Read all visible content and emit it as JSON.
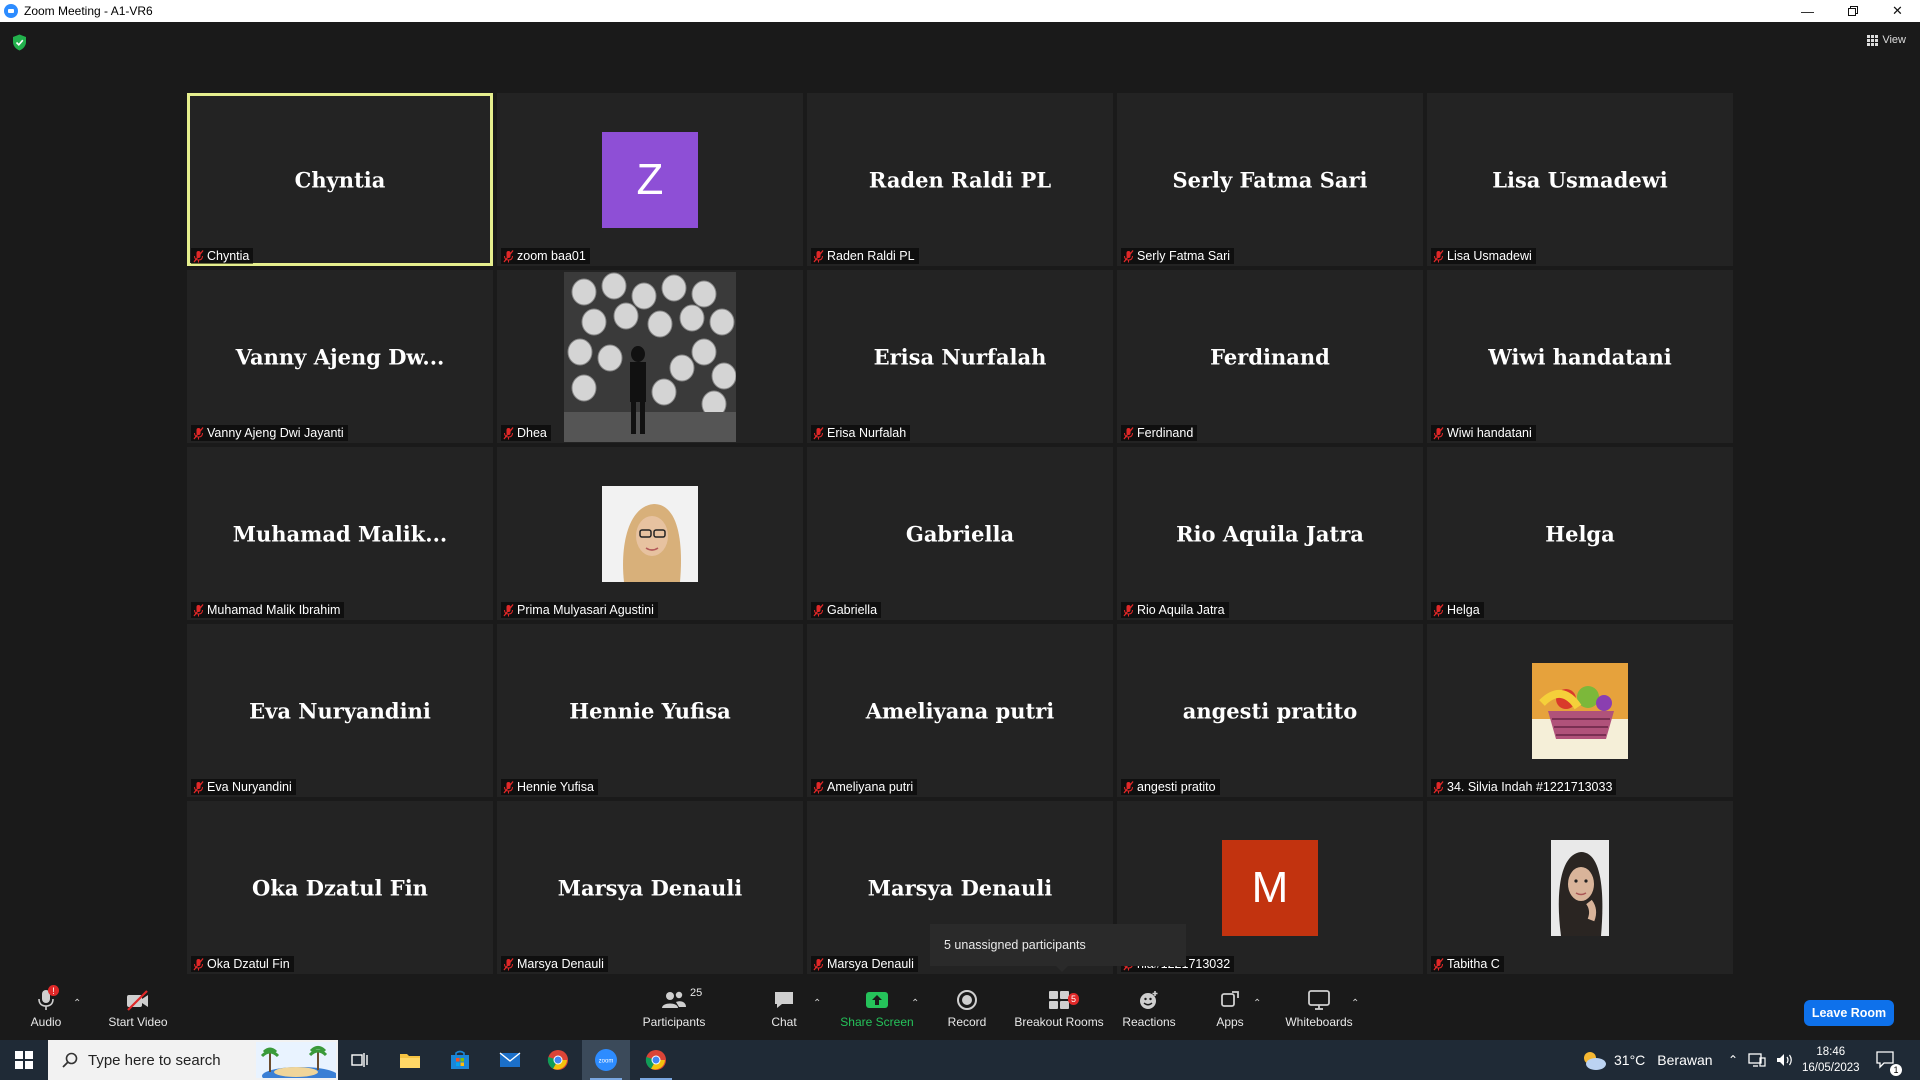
{
  "window": {
    "title": "Zoom Meeting - A1-VR6",
    "view_label": "View"
  },
  "tiles": [
    {
      "big": "Chyntia",
      "label": "Chyntia",
      "active": true
    },
    {
      "big": "",
      "label": "zoom baa01",
      "avatar_letter": "Z",
      "avatar_color": "#8e4fd6"
    },
    {
      "big": "Raden Raldi PL",
      "label": "Raden Raldi PL"
    },
    {
      "big": "Serly Fatma Sari",
      "label": "Serly Fatma Sari"
    },
    {
      "big": "Lisa Usmadewi",
      "label": "Lisa Usmadewi"
    },
    {
      "big": "Vanny  Ajeng  Dw...",
      "label": "Vanny Ajeng Dwi Jayanti"
    },
    {
      "big": "",
      "label": "Dhea",
      "photo": "lanterns"
    },
    {
      "big": "Erisa Nurfalah",
      "label": "Erisa Nurfalah"
    },
    {
      "big": "Ferdinand",
      "label": "Ferdinand"
    },
    {
      "big": "Wiwi handatani",
      "label": "Wiwi handatani"
    },
    {
      "big": "Muhamad  Malik...",
      "label": "Muhamad Malik Ibrahim"
    },
    {
      "big": "",
      "label": "Prima Mulyasari Agustini",
      "photo": "portrait-hijab"
    },
    {
      "big": "Gabriella",
      "label": "Gabriella"
    },
    {
      "big": "Rio Aquila Jatra",
      "label": "Rio Aquila Jatra"
    },
    {
      "big": "Helga",
      "label": "Helga"
    },
    {
      "big": "Eva Nuryandini",
      "label": "Eva Nuryandini"
    },
    {
      "big": "Hennie Yufisa",
      "label": "Hennie Yufisa"
    },
    {
      "big": "Ameliyana putri",
      "label": "Ameliyana putri"
    },
    {
      "big": "angesti pratito",
      "label": "angesti pratito"
    },
    {
      "big": "",
      "label": "34. Silvia Indah #1221713033",
      "photo": "fruit-basket"
    },
    {
      "big": "Oka Dzatul Fin",
      "label": "Oka Dzatul Fin"
    },
    {
      "big": "Marsya Denauli",
      "label": "Marsya Denauli"
    },
    {
      "big": "Marsya Denauli",
      "label": "Marsya Denauli"
    },
    {
      "big": "",
      "label": "nia#1221713032",
      "avatar_letter": "M",
      "avatar_color": "#c2330f"
    },
    {
      "big": "",
      "label": "Tabitha C",
      "photo": "portrait-girl"
    }
  ],
  "tooltip": "5 unassigned participants",
  "toolbar": {
    "audio": "Audio",
    "audio_badge": "!",
    "start_video": "Start Video",
    "participants": "Participants",
    "participants_count": "25",
    "chat": "Chat",
    "share_screen": "Share Screen",
    "record": "Record",
    "breakout_rooms": "Breakout Rooms",
    "breakout_badge": "5",
    "reactions": "Reactions",
    "apps": "Apps",
    "whiteboards": "Whiteboards",
    "leave_room": "Leave Room"
  },
  "taskbar": {
    "search_placeholder": "Type here to search",
    "temperature": "31°C",
    "weather": "Berawan",
    "time": "18:46",
    "date": "16/05/2023",
    "notification_count": "1"
  }
}
